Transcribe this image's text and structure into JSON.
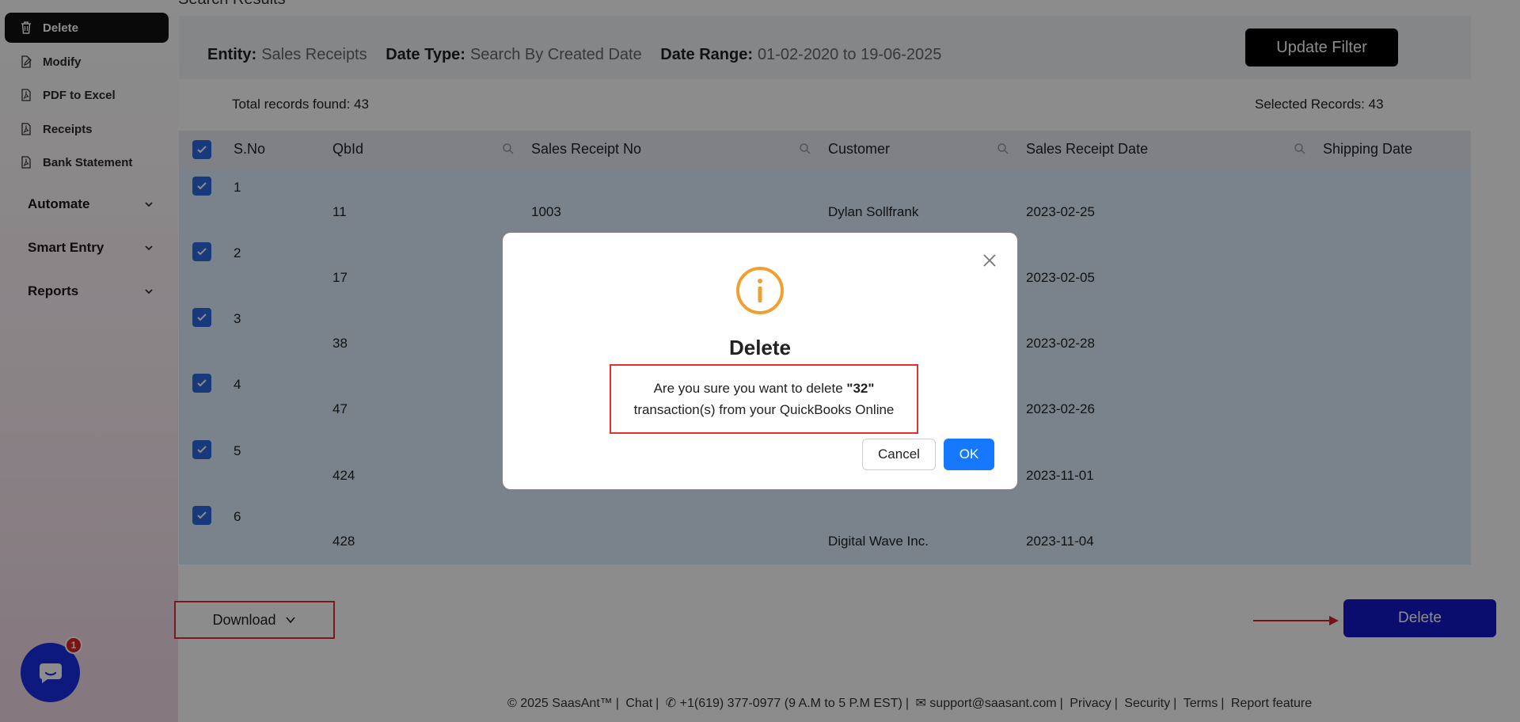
{
  "sidebar": {
    "items": [
      {
        "label": "Delete",
        "icon": "trash-icon",
        "active": true
      },
      {
        "label": "Modify",
        "icon": "edit-icon"
      },
      {
        "label": "PDF to Excel",
        "icon": "pdf-icon"
      },
      {
        "label": "Receipts",
        "icon": "pdf-icon"
      },
      {
        "label": "Bank Statement",
        "icon": "pdf-icon"
      }
    ],
    "groups": [
      {
        "label": "Automate"
      },
      {
        "label": "Smart Entry"
      },
      {
        "label": "Reports"
      }
    ]
  },
  "page": {
    "title": "Search Results"
  },
  "filter": {
    "entity_label": "Entity:",
    "entity_value": "Sales Receipts",
    "date_type_label": "Date Type:",
    "date_type_value": "Search By Created Date",
    "date_range_label": "Date Range:",
    "date_range_value": "01-02-2020 to 19-06-2025",
    "update_button": "Update Filter"
  },
  "counts": {
    "total": "Total records found: 43",
    "selected": "Selected Records: 43"
  },
  "table": {
    "headers": [
      "S.No",
      "QbId",
      "Sales Receipt No",
      "Customer",
      "Sales Receipt Date",
      "Shipping Date"
    ],
    "rows": [
      {
        "sno": "1",
        "qbid": "11",
        "receipt_no": "1003",
        "customer": "Dylan Sollfrank",
        "date": "2023-02-25"
      },
      {
        "sno": "2",
        "qbid": "17",
        "receipt_no": "",
        "customer": "",
        "date": "2023-02-05"
      },
      {
        "sno": "3",
        "qbid": "38",
        "receipt_no": "",
        "customer": "",
        "date": "2023-02-28"
      },
      {
        "sno": "4",
        "qbid": "47",
        "receipt_no": "",
        "customer": "",
        "date": "2023-02-26"
      },
      {
        "sno": "5",
        "qbid": "424",
        "receipt_no": "",
        "customer": "",
        "date": "2023-11-01"
      },
      {
        "sno": "6",
        "qbid": "428",
        "receipt_no": "",
        "customer": "Digital Wave Inc.",
        "date": "2023-11-04"
      }
    ]
  },
  "actions": {
    "download": "Download",
    "delete": "Delete"
  },
  "chat": {
    "badge": "1"
  },
  "footer": {
    "copyright": "© 2025 SaasAnt™",
    "chat": "Chat",
    "phone": "+1(619) 377-0977 (9 A.M to 5 P.M EST)",
    "email": "support@saasant.com",
    "privacy": "Privacy",
    "security": "Security",
    "terms": "Terms",
    "report": "Report feature"
  },
  "modal": {
    "title": "Delete",
    "msg_prefix": "Are you sure you want to delete ",
    "msg_count": "\"32\"",
    "msg_line2": "transaction(s) from your QuickBooks Online",
    "cancel": "Cancel",
    "ok": "OK",
    "icon": "info-icon",
    "accent": "#f0a030"
  }
}
